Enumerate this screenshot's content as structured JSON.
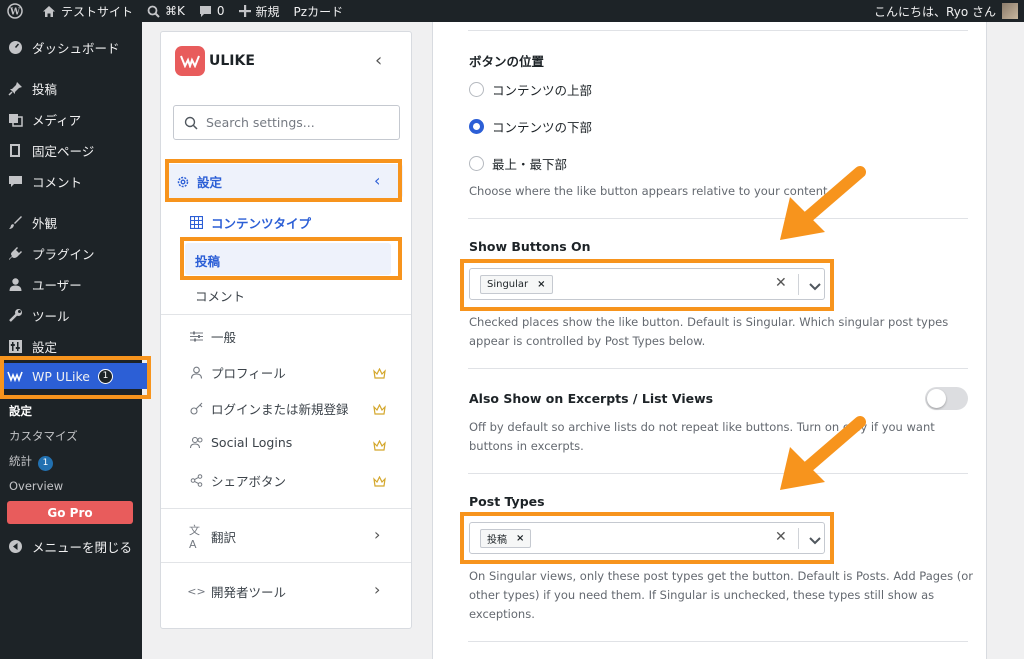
{
  "adminbar": {
    "site_name": "テストサイト",
    "shortcut": "⌘K",
    "comments_count": "0",
    "new_label": "新規",
    "pz_card": "Pzカード",
    "greeting": "こんにちは、Ryo さん"
  },
  "adminmenu": {
    "dashboard": "ダッシュボード",
    "posts": "投稿",
    "media": "メディア",
    "pages": "固定ページ",
    "comments": "コメント",
    "appearance": "外観",
    "plugins": "プラグイン",
    "users": "ユーザー",
    "tools": "ツール",
    "settings": "設定",
    "wpulike": "WP ULike",
    "wpulike_badge": "1",
    "sub_settings": "設定",
    "sub_customize": "カスタマイズ",
    "sub_stats": "統計",
    "sub_stats_badge": "1",
    "sub_overview": "Overview",
    "go_pro": "Go Pro",
    "collapse": "メニューを閉じる"
  },
  "panel": {
    "logo_text": "ULIKE",
    "search_placeholder": "Search settings...",
    "nav_settings": "設定",
    "nav_content_types": "コンテンツタイプ",
    "nav_posts": "投稿",
    "nav_comments": "コメント",
    "nav_general": "一般",
    "nav_profile": "プロフィール",
    "nav_login": "ログインまたは新規登録",
    "nav_social": "Social Logins",
    "nav_share": "シェアボタン",
    "nav_translate": "翻訳",
    "nav_developer": "開発者ツール"
  },
  "main": {
    "button_position_label": "ボタンの位置",
    "radio_top": "コンテンツの上部",
    "radio_bottom": "コンテンツの下部",
    "radio_both": "最上・最下部",
    "button_position_desc": "Choose where the like button appears relative to your content.",
    "show_buttons_label": "Show Buttons On",
    "show_buttons_tag": "Singular",
    "show_buttons_desc": "Checked places show the like button. Default is Singular. Which singular post types appear is controlled by Post Types below.",
    "excerpts_label": "Also Show on Excerpts / List Views",
    "excerpts_desc": "Off by default so archive lists do not repeat like buttons. Turn on only if you want buttons in excerpts.",
    "post_types_label": "Post Types",
    "post_types_tag": "投稿",
    "post_types_desc": "On Singular views, only these post types get the button. Default is Posts. Add Pages (or other types) if you need them. If Singular is unchecked, these types still show as exceptions."
  },
  "colors": {
    "accent": "#2c5fd6",
    "highlight": "#f7941d",
    "brand": "#e85c5c"
  }
}
